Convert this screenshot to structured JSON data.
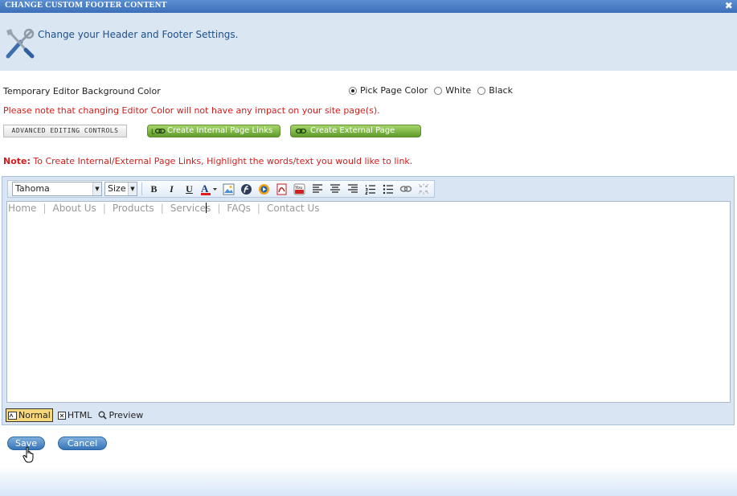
{
  "window": {
    "title": "CHANGE CUSTOM FOOTER CONTENT",
    "close_icon": "close-icon"
  },
  "header": {
    "icon": "tools-icon",
    "text": "Change your Header and Footer Settings."
  },
  "bg_color": {
    "label": "Temporary Editor Background Color",
    "options": [
      {
        "label": "Pick Page Color",
        "selected": true
      },
      {
        "label": "White",
        "selected": false
      },
      {
        "label": "Black",
        "selected": false
      }
    ],
    "warning": "Please note that changing Editor Color will not have any impact on your site page(s)."
  },
  "buttons": {
    "advanced": "ADVANCED EDITING CONTROLS",
    "internal_links": "Create Internal Page Links",
    "external_links": "Create External Page Links"
  },
  "note": {
    "prefix": "Note:",
    "text": " To Create Internal/External Page Links, Highlight the words/text you would like to link."
  },
  "editor": {
    "font_select": "Tahoma",
    "size_select": "Size",
    "toolbar_icons": [
      "bold-icon",
      "italic-icon",
      "underline-icon",
      "font-color-icon",
      "image-icon",
      "flash-icon",
      "media-icon",
      "pdf-icon",
      "youtube-icon",
      "align-left-icon",
      "align-center-icon",
      "align-right-icon",
      "ordered-list-icon",
      "unordered-list-icon",
      "link-icon",
      "unlink-icon"
    ],
    "toolbar_labels": {
      "bold": "B",
      "italic": "I",
      "underline": "U",
      "font_color": "A",
      "youtube": "You"
    },
    "content_links": [
      "Home",
      "About Us",
      "Products",
      "Services",
      "FAQs",
      "Contact Us"
    ],
    "modes": [
      {
        "label": "Normal",
        "active": true
      },
      {
        "label": "HTML",
        "active": false
      },
      {
        "label": "Preview",
        "active": false
      }
    ]
  },
  "actions": {
    "save": "Save",
    "cancel": "Cancel"
  },
  "colors": {
    "title_bar": "#3c6fb8",
    "warning_red": "#d01c1c",
    "header_band": "#dbe6f3",
    "green_button": "#6aa832"
  }
}
